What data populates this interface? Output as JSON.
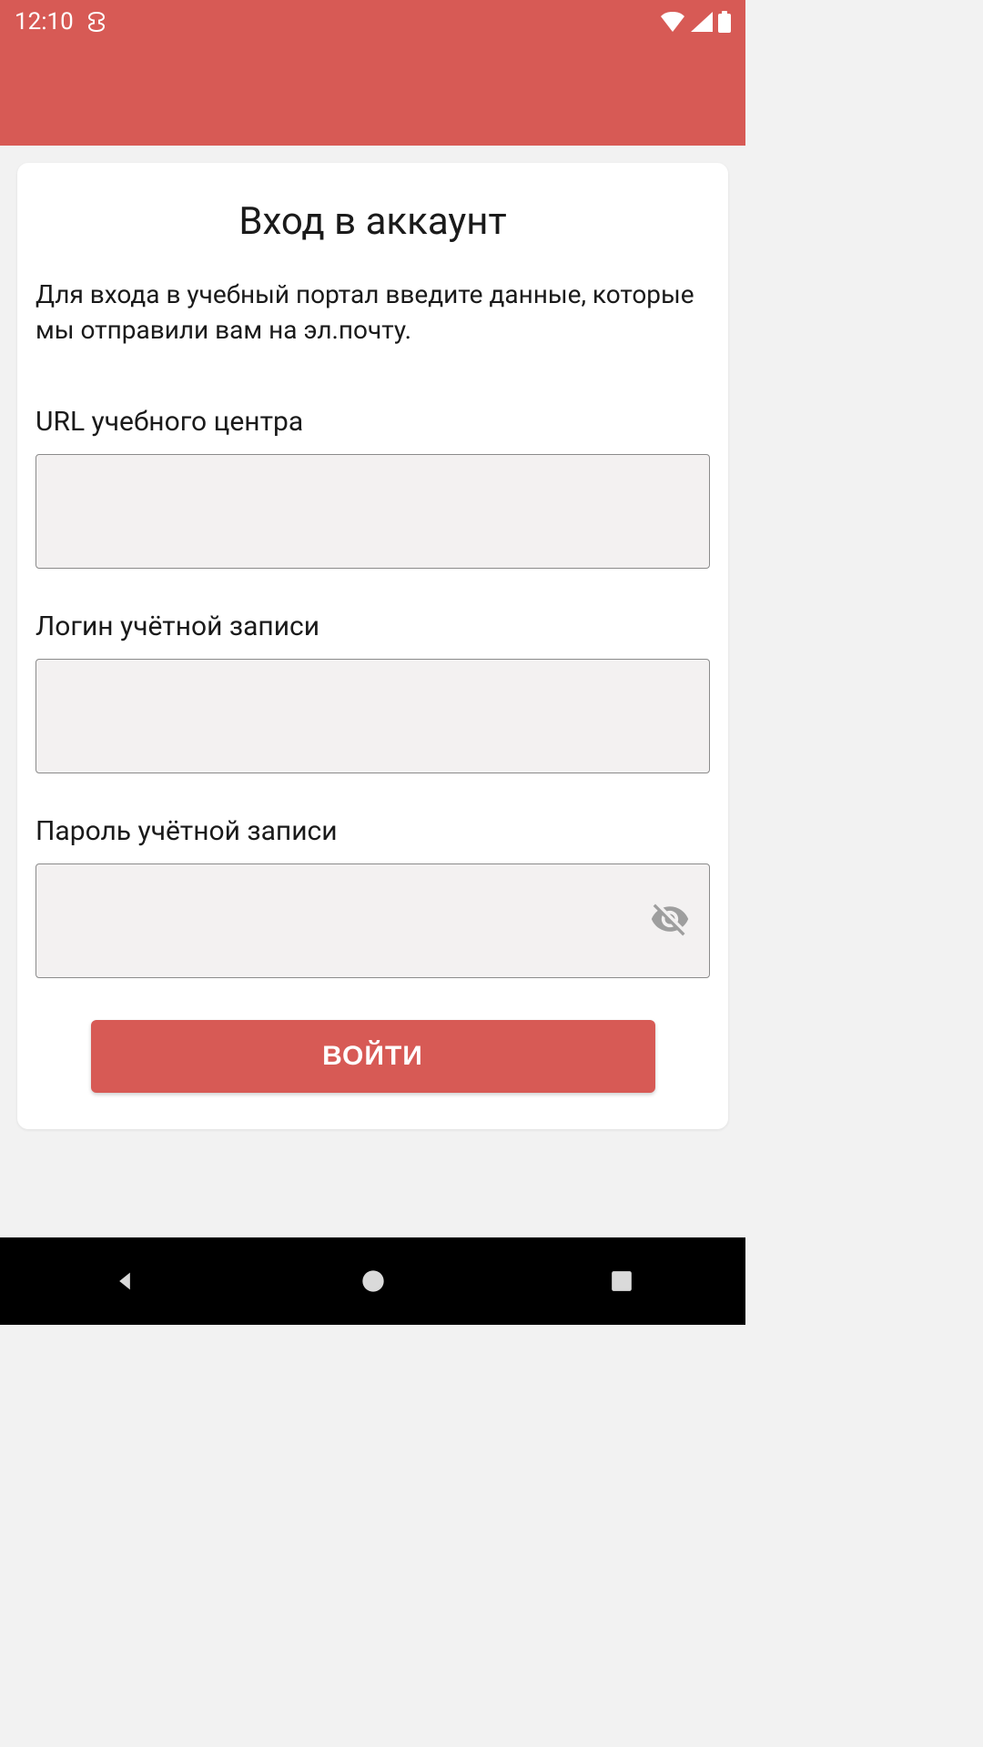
{
  "colors": {
    "primary": "#d75a55",
    "text": "#1a1a1a",
    "iconGray": "#9e9e9e"
  },
  "statusBar": {
    "time": "12:10"
  },
  "login": {
    "title": "Вход в аккаунт",
    "description": "Для входа в учебный портал введите данные, которые мы отправили вам на эл.почту.",
    "urlLabel": "URL учебного центра",
    "urlValue": "",
    "loginLabel": "Логин учётной записи",
    "loginValue": "",
    "passwordLabel": "Пароль учётной записи",
    "passwordValue": "",
    "submitLabel": "ВОЙТИ"
  }
}
